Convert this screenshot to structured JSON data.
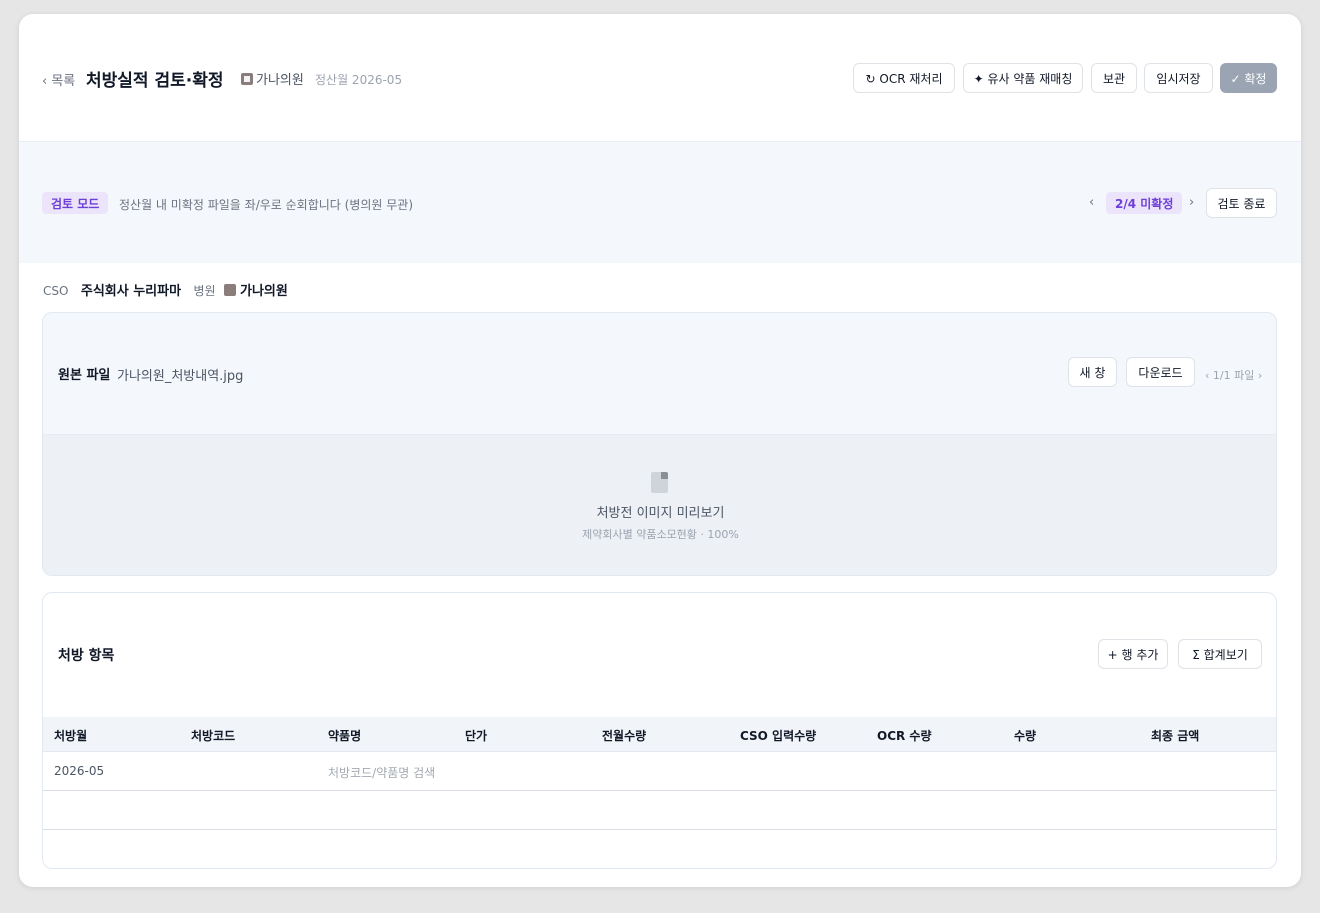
{
  "header": {
    "back_label": "‹ 목록",
    "title": "처방실적 검토·확정",
    "hospital": "가나의원",
    "settlement_month": "정산월 2026-05",
    "actions": {
      "ocr_reprocess": "↻ OCR 재처리",
      "similar_rematch": "✦ 유사 약품 재매칭",
      "hold": "보관",
      "temp_save": "임시저장",
      "confirm": "✓ 확정"
    }
  },
  "review_mode": {
    "badge": "검토 모드",
    "description": "정산월 내 미확정 파일을 좌/우로 순회합니다 (병의원 무관)",
    "prev": "‹",
    "counter": "2/4 미확정",
    "next": "›",
    "end_label": "검토 종료"
  },
  "info": {
    "cso_label": "CSO",
    "cso_value": "주식회사 누리파마",
    "hospital_label": "병원",
    "hospital_value": "가나의원"
  },
  "file_panel": {
    "label": "원본 파일",
    "file_name": "가나의원_처방내역.jpg",
    "new_window": "새 창",
    "download": "다운로드",
    "pager": "‹ 1/1 파일 ›",
    "preview_title": "처방전 이미지 미리보기",
    "preview_sub": "제약회사별 약품소모현황 · 100%"
  },
  "items_panel": {
    "title": "처방 항목",
    "add_row": "+ 행 추가",
    "show_total": "Σ 합계보기",
    "columns": [
      "처방월",
      "처방코드",
      "약품명",
      "단가",
      "전월수량",
      "CSO 입력수량",
      "OCR 수량",
      "수량",
      "최종 금액"
    ],
    "rows": [
      {
        "month": "2026-05",
        "code": "",
        "drug_placeholder": "처방코드/약품명 검색"
      }
    ]
  }
}
